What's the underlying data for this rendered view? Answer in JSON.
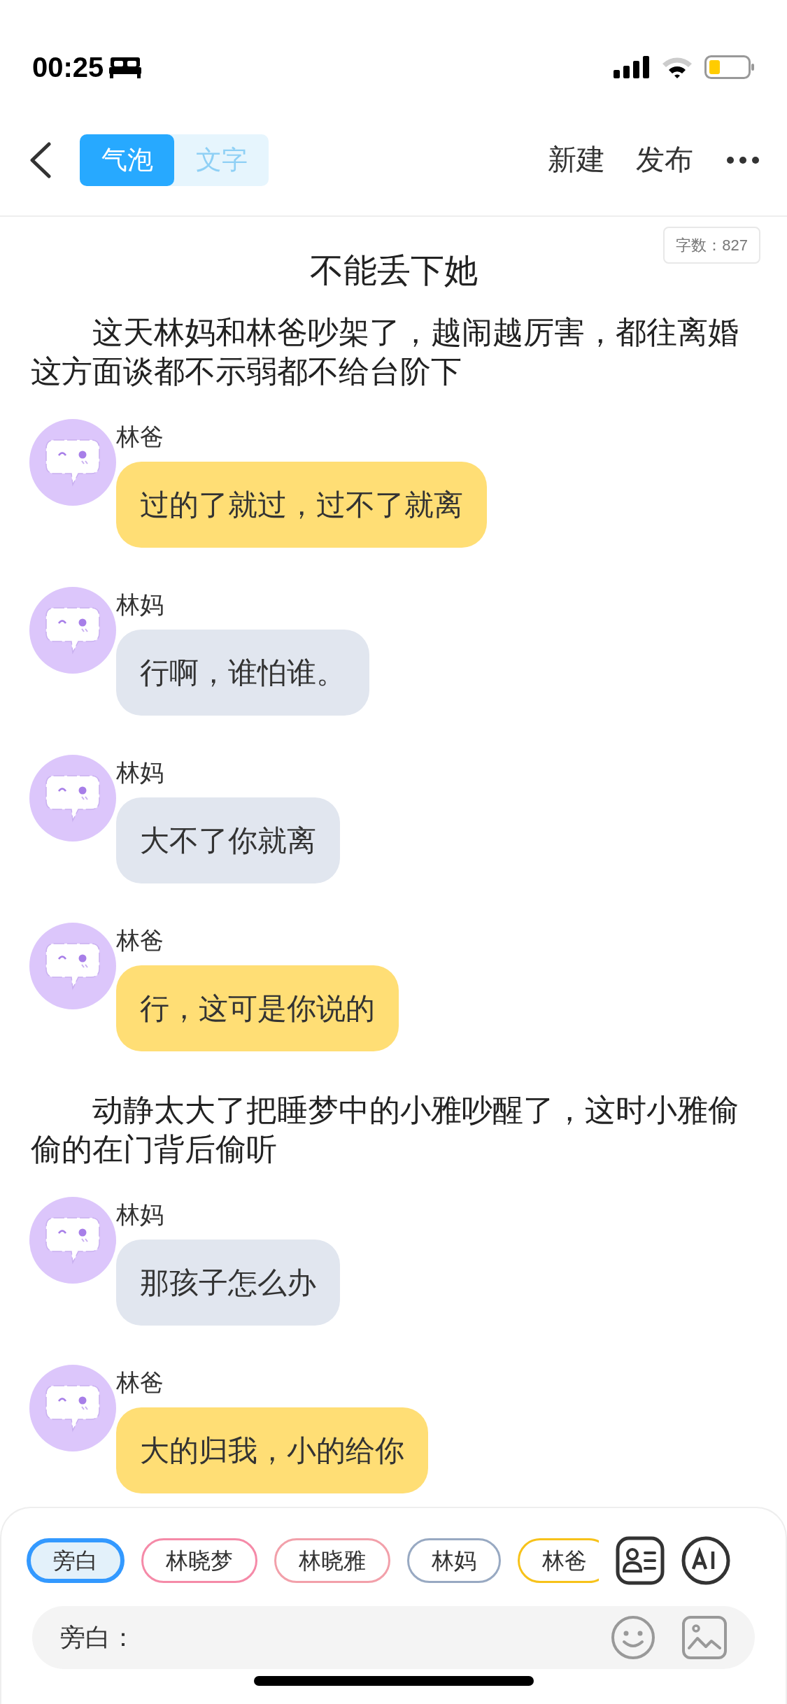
{
  "status_bar": {
    "time": "00:25"
  },
  "header": {
    "tabs": [
      {
        "label": "气泡",
        "selected": true
      },
      {
        "label": "文字",
        "selected": false
      }
    ],
    "actions": [
      "新建",
      "发布"
    ]
  },
  "word_count": "字数：827",
  "title": "不能丢下她",
  "story": [
    {
      "kind": "narration",
      "text": "这天林妈和林爸吵架了，越闹越厉害，都往离婚这方面谈都不示弱都不给台阶下"
    },
    {
      "kind": "message",
      "speaker": "林爸",
      "text": "过的了就过，过不了就离",
      "color": "#ffde75"
    },
    {
      "kind": "message",
      "speaker": "林妈",
      "text": "行啊，谁怕谁。",
      "color": "#e1e6ef"
    },
    {
      "kind": "message",
      "speaker": "林妈",
      "text": "大不了你就离",
      "color": "#e1e6ef"
    },
    {
      "kind": "message",
      "speaker": "林爸",
      "text": "行，这可是你说的",
      "color": "#ffde75"
    },
    {
      "kind": "narration",
      "text": "动静太大了把睡梦中的小雅吵醒了，这时小雅偷偷的在门背后偷听"
    },
    {
      "kind": "message",
      "speaker": "林妈",
      "text": "那孩子怎么办",
      "color": "#e1e6ef"
    },
    {
      "kind": "message",
      "speaker": "林爸",
      "text": "大的归我，小的给你",
      "color": "#ffde75"
    }
  ],
  "composer": {
    "chips": [
      {
        "label": "旁白",
        "color": "#3399ff",
        "selected": true
      },
      {
        "label": "林晓梦",
        "color": "#f58aa8",
        "selected": false
      },
      {
        "label": "林晓雅",
        "color": "#f2a0aa",
        "selected": false
      },
      {
        "label": "林妈",
        "color": "#98a9c2",
        "selected": false
      },
      {
        "label": "林爸",
        "color": "#f7c21a",
        "selected": false
      }
    ],
    "prefix": "旁白："
  }
}
